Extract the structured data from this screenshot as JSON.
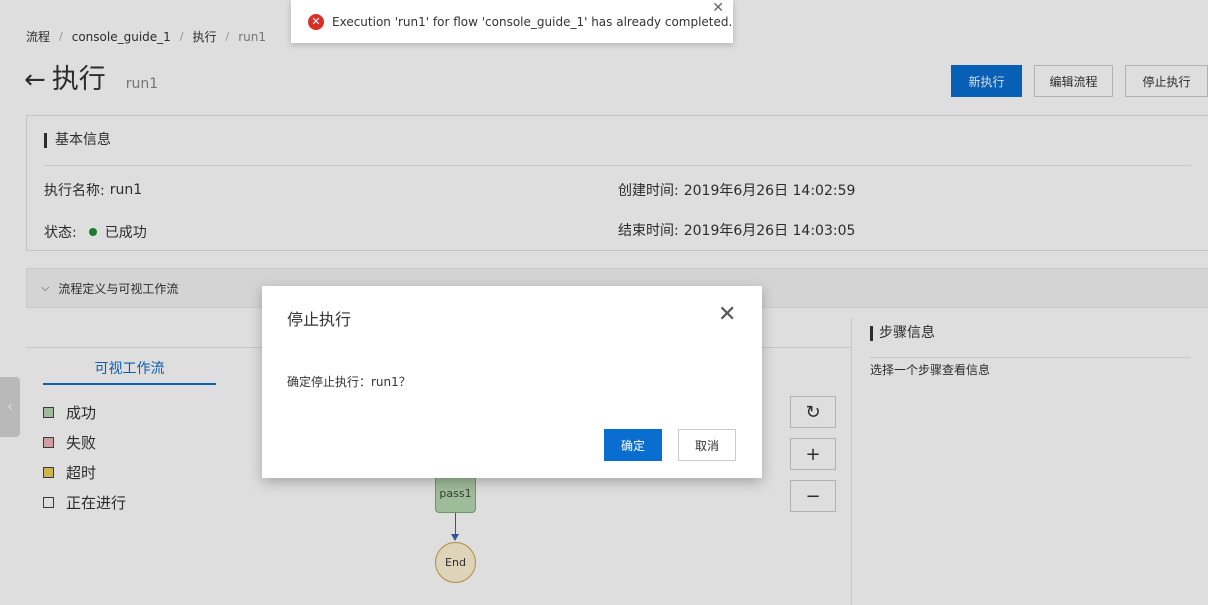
{
  "breadcrumb": [
    "流程",
    "console_guide_1",
    "执行",
    "run1"
  ],
  "header": {
    "title": "执行",
    "subtitle": "run1",
    "buttons": {
      "new_execution": "新执行",
      "edit_flow": "编辑流程",
      "stop_execution": "停止执行"
    }
  },
  "basic_info": {
    "title": "基本信息",
    "name_label": "执行名称:",
    "name_value": "run1",
    "status_label": "状态:",
    "status_value": "已成功",
    "created_label": "创建时间:",
    "created_value": "2019年6月26日 14:02:59",
    "ended_label": "结束时间:",
    "ended_value": "2019年6月26日 14:03:05"
  },
  "flow_section": {
    "title": "流程定义与可视工作流",
    "tab": "可视工作流",
    "legend": [
      {
        "label": "成功",
        "color": "#b7d8b1"
      },
      {
        "label": "失败",
        "color": "#f1b5b7"
      },
      {
        "label": "超时",
        "color": "#e8d35a"
      },
      {
        "label": "正在进行",
        "color": "#ffffff"
      }
    ],
    "controls": [
      "↻",
      "+",
      "−"
    ],
    "nodes": {
      "pass": "pass1",
      "end": "End"
    }
  },
  "step_info": {
    "title": "步骤信息",
    "hint": "选择一个步骤查看信息"
  },
  "toast": {
    "message": "Execution 'run1' for flow 'console_guide_1' has already completed."
  },
  "modal": {
    "title": "停止执行",
    "body": "确定停止执行：run1？",
    "confirm": "确定",
    "cancel": "取消"
  },
  "colors": {
    "primary": "#0a6ed1",
    "success": "#1e8e3e",
    "error": "#d93026"
  }
}
